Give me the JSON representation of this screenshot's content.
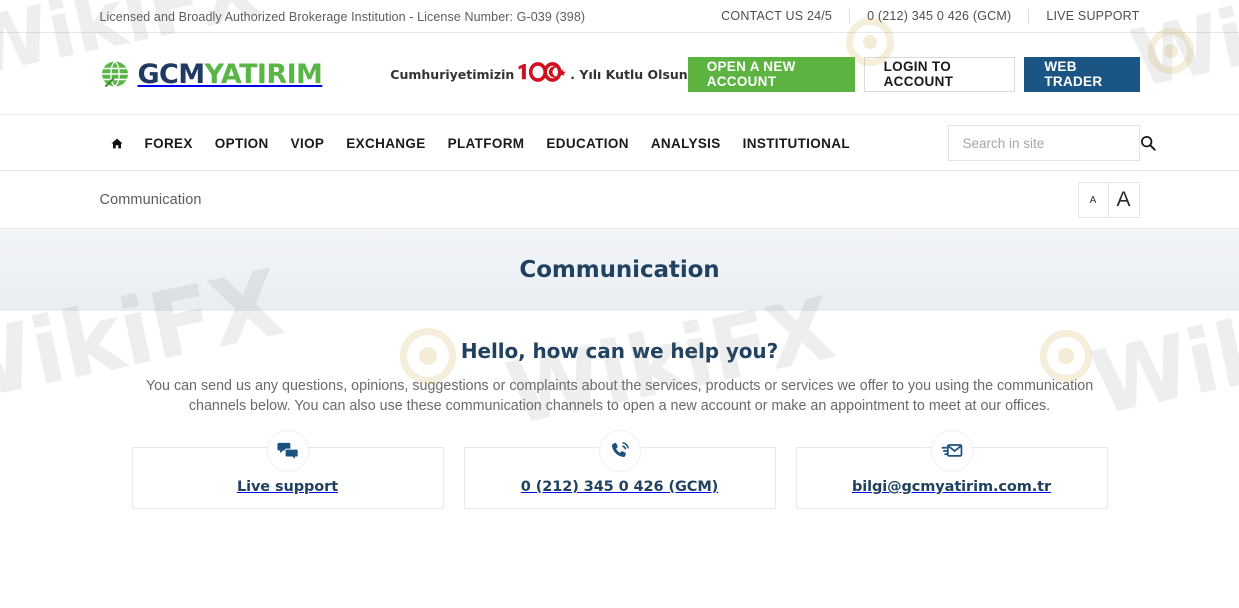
{
  "topbar": {
    "license_text": "Licensed and Broadly Authorized Brokerage Institution - License Number: G-039 (398)",
    "links": [
      {
        "label": "CONTACT US 24/5",
        "name": "contact-us-link"
      },
      {
        "label": "0 (212) 345 0 426 (GCM)",
        "name": "phone-link"
      },
      {
        "label": "LIVE SUPPORT",
        "name": "live-support-link"
      }
    ]
  },
  "header": {
    "logo": {
      "part1": "GCM",
      "part2": "YATIRIM",
      "icon": "globe-icon"
    },
    "centennial": {
      "prefix": "Cumhuriyetimizin",
      "number": "100",
      "suffix": ". Yılı Kutlu Olsun"
    },
    "buttons": [
      {
        "label": "OPEN A NEW ACCOUNT",
        "name": "open-new-account-button",
        "style": "green"
      },
      {
        "label": "LOGIN TO ACCOUNT",
        "name": "login-to-account-button",
        "style": "white"
      },
      {
        "label": "WEB TRADER",
        "name": "web-trader-button",
        "style": "blue"
      }
    ]
  },
  "nav": {
    "home_icon": "home-icon",
    "items": [
      {
        "label": "FOREX"
      },
      {
        "label": "OPTION"
      },
      {
        "label": "VIOP"
      },
      {
        "label": "EXCHANGE"
      },
      {
        "label": "PLATFORM"
      },
      {
        "label": "EDUCATION"
      },
      {
        "label": "ANALYSIS"
      },
      {
        "label": "INSTITUTIONAL"
      }
    ],
    "search": {
      "placeholder": "Search in site",
      "value": "",
      "icon": "search-icon"
    }
  },
  "breadcrumb": {
    "label": "Communication",
    "font_size_small": "A",
    "font_size_large": "A"
  },
  "banner": {
    "title": "Communication"
  },
  "main": {
    "heading": "Hello, how can we help you?",
    "intro": "You can send us any questions, opinions, suggestions or complaints about the services, products or services we offer to you using the communication channels below. You can also use these communication channels to open a new account or make an appointment to meet at our offices.",
    "cards": [
      {
        "label": "Live support",
        "icon": "chat-bubbles-icon",
        "name": "card-live-support"
      },
      {
        "label": "0 (212) 345 0 426 (GCM)",
        "icon": "phone-ring-icon",
        "name": "card-phone"
      },
      {
        "label": "bilgi@gcmyatirim.com.tr",
        "icon": "envelope-icon",
        "name": "card-email"
      }
    ]
  },
  "watermarks": [
    {
      "text": "WikiFX"
    },
    {
      "text": "WikiFX"
    },
    {
      "text": "WikiFX"
    },
    {
      "text": "WikiFX"
    },
    {
      "text": "WikiFX"
    }
  ],
  "colors": {
    "accent_green": "#5cb340",
    "accent_blue": "#1b5583",
    "heading_navy": "#20415f",
    "logo_navy": "#1f3a63",
    "logo_green": "#5ab547"
  }
}
